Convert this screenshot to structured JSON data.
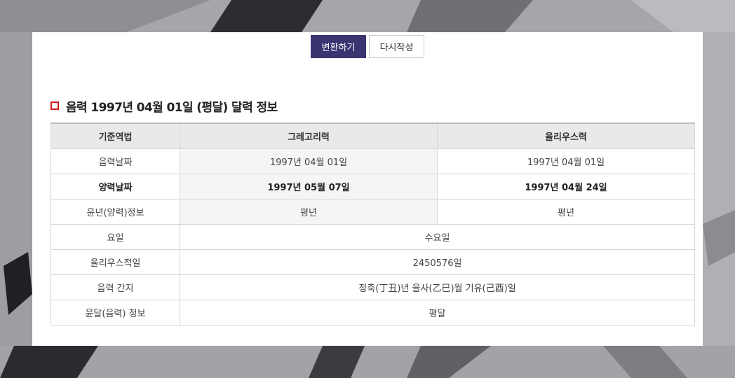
{
  "buttons": {
    "convert": "변환하기",
    "reset": "다시작성"
  },
  "heading": "음력 1997년 04월 01일 (평달) 달력 정보",
  "table": {
    "headers": [
      "기준역법",
      "그레고리력",
      "율리우스력"
    ],
    "rows": {
      "lunar_date": {
        "label": "음력날짜",
        "gregorian": "1997년 04월 01일",
        "julian": "1997년 04월 01일"
      },
      "solar_date": {
        "label": "양력날짜",
        "gregorian": "1997년 05월 07일",
        "julian": "1997년 04월 24일"
      },
      "leap_year": {
        "label": "윤년(양력)정보",
        "gregorian": "평년",
        "julian": "평년"
      },
      "weekday": {
        "label": "요일",
        "value": "수요일"
      },
      "julian_day": {
        "label": "율리우스적일",
        "value": "2450576일"
      },
      "ganji": {
        "label": "음력 간지",
        "value": "정축(丁丑)년 을사(乙巳)월 기유(己酉)일"
      },
      "leap_month": {
        "label": "윤달(음력) 정보",
        "value": "평달"
      }
    }
  },
  "colors": {
    "primary_button": "#3a3570",
    "heading_square": "#d51a1a",
    "header_bg": "#e9e9e9"
  },
  "icons": {
    "heading_marker": "red-square-icon"
  }
}
